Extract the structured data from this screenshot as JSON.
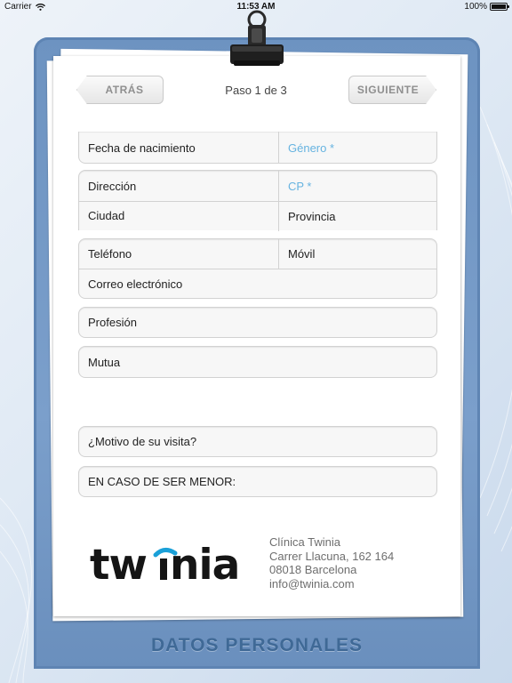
{
  "status_bar": {
    "carrier": "Carrier",
    "time": "11:53 AM",
    "battery": "100%"
  },
  "nav": {
    "back_label": "ATRÁS",
    "step_label": "Paso 1 de 3",
    "next_label": "SIGUIENTE"
  },
  "form": {
    "birth_date": "Fecha de nacimiento",
    "gender": "Género *",
    "address": "Dirección",
    "postal_code": "CP *",
    "city": "Ciudad",
    "province": "Provincia",
    "phone": "Teléfono",
    "mobile": "Móvil",
    "email": "Correo electrónico",
    "profession": "Profesión",
    "insurance": "Mutua",
    "visit_reason": "¿Motivo de su visita?",
    "minor": "EN CASO DE SER MENOR:"
  },
  "footer": {
    "logo_text": "twinia",
    "clinic_name": "Clínica Twinia",
    "street": "Carrer Llacuna, 162 164",
    "city": "08018 Barcelona",
    "email": "info@twinia.com"
  },
  "board": {
    "title": "DATOS PERSONALES"
  },
  "icons": {
    "wifi": "wifi-icon",
    "battery": "battery-icon",
    "clip": "binder-clip-icon"
  },
  "colors": {
    "board": "#7b9fcb",
    "placeholder": "#66b3e0",
    "title": "#3f6996"
  }
}
